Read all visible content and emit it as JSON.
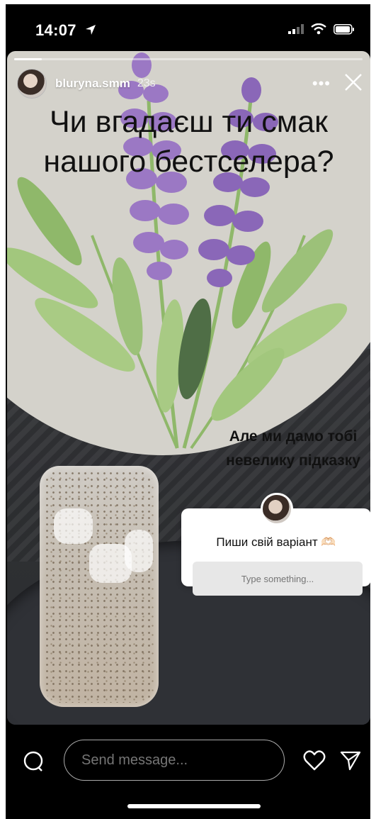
{
  "status_bar": {
    "time": "14:07"
  },
  "story": {
    "username": "bluryna.smm",
    "timestamp": "23s",
    "progress": 0.08,
    "headline_line1": "Чи вгадаєш ти смак",
    "headline_line2": "нашого бестселера?",
    "hint_line1": "Але ми дамо тобі",
    "hint_line2": "невелику підказку",
    "question": {
      "text": "Пиши свій варіант 🫶🏻",
      "placeholder": "Type something..."
    }
  },
  "bottom": {
    "message_placeholder": "Send message..."
  },
  "icons": [
    "location-arrow-icon",
    "signal-icon",
    "wifi-icon",
    "battery-icon",
    "more-icon",
    "close-icon",
    "camera-icon",
    "heart-icon",
    "send-icon"
  ],
  "colors": {
    "background": "#000000",
    "card": "#d4d2cb",
    "lavender": "#9b78c4",
    "leaf": "#8fb86a"
  }
}
